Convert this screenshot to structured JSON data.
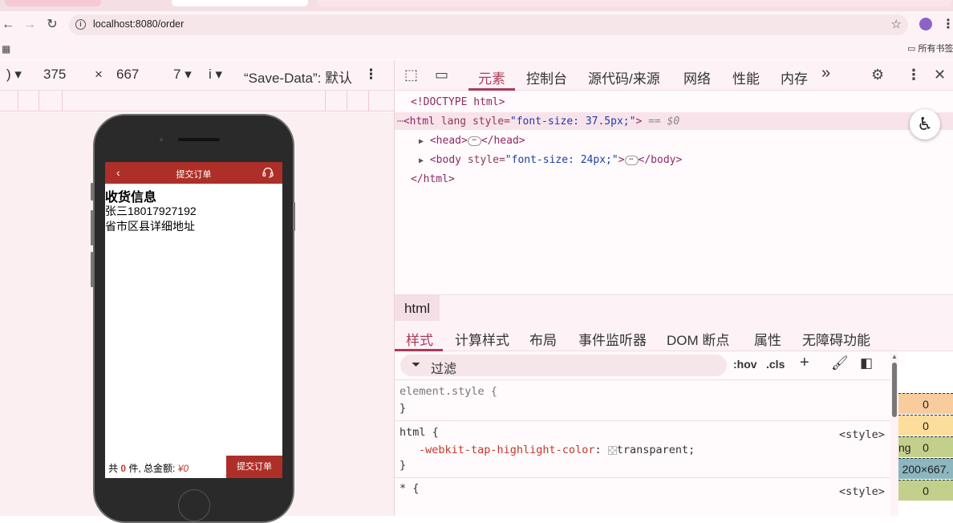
{
  "browser": {
    "url": "localhost:8080/order",
    "bookmark_folder": "所有书签"
  },
  "device_toolbar": {
    "device_dropdown": ")",
    "width": "375",
    "times": "×",
    "height": "667",
    "zoom_dropdown": "7",
    "throttle_dropdown": "i",
    "save_data": "“Save-Data”: 默认"
  },
  "phone_app": {
    "header_title": "提交订单",
    "section_title": "收货信息",
    "person": "张三18017927192",
    "address": "省市区县详细地址",
    "summary_prefix": "共",
    "item_count": "0",
    "summary_suffix": "件, 总金额:",
    "total_amount": "¥0",
    "submit_label": "提交订单"
  },
  "devtools": {
    "tabs": [
      "元素",
      "控制台",
      "源代码/来源",
      "网络",
      "性能",
      "内存"
    ],
    "more_label": "»",
    "dom": {
      "doctype": "<!DOCTYPE html>",
      "html_open": "<html",
      "html_attr_lang": "lang",
      "html_attr_style": "style=",
      "html_style_val": "\"font-size: 37.5px;\"",
      "html_close_bracket": ">",
      "html_eq": "== $0",
      "head_open": "<head>",
      "head_close": "</head>",
      "body_open": "<body",
      "body_attr_style": "style=",
      "body_style_val": "\"font-size: 24px;\"",
      "body_gt": ">",
      "body_close": "</body>",
      "html_end": "</html>"
    },
    "breadcrumb": "html",
    "styles_tabs": [
      "样式",
      "计算样式",
      "布局",
      "事件监听器",
      "DOM 断点",
      "属性",
      "无障碍功能"
    ],
    "filter_placeholder": "过滤",
    "hov": ":hov",
    "cls": ".cls",
    "rules": {
      "element_style": "element.style {",
      "close": "}",
      "html_selector": "html {",
      "html_prop": "-webkit-tap-highlight-color",
      "html_value": "transparent;",
      "source": "<style>",
      "star_selector": "* {"
    },
    "box_model": [
      "0",
      "0",
      "0",
      "200×667.",
      "0"
    ],
    "box_model_label": "ng"
  },
  "colors": {
    "brand_red": "#ad2f27",
    "devtools_accent": "#ad3958"
  }
}
